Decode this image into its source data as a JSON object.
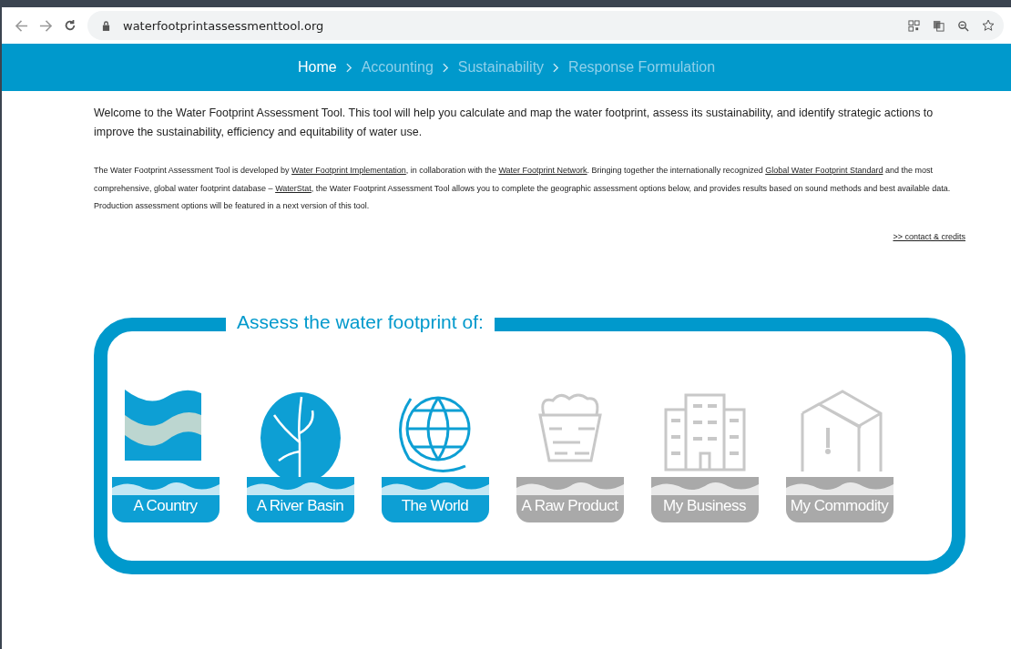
{
  "browser": {
    "url": "waterfootprintassessmenttool.org"
  },
  "breadcrumb": [
    {
      "label": "Home",
      "selected": true
    },
    {
      "label": "Accounting",
      "selected": false
    },
    {
      "label": "Sustainability",
      "selected": false
    },
    {
      "label": "Response Formulation",
      "selected": false
    }
  ],
  "intro": "Welcome to the Water Footprint Assessment Tool. This tool will help you calculate and map the water footprint, assess its sustainability, and identify strategic actions to improve the sustainability, efficiency and equitability of water use.",
  "description": [
    {
      "kind": "text",
      "text": "The Water Footprint Assessment Tool is developed by "
    },
    {
      "kind": "link",
      "text": "Water Footprint Implementation"
    },
    {
      "kind": "text",
      "text": ", in collaboration with the "
    },
    {
      "kind": "link",
      "text": "Water Footprint Network"
    },
    {
      "kind": "text",
      "text": ". Bringing together the internationally recognized "
    },
    {
      "kind": "link",
      "text": "Global Water Footprint Standard"
    },
    {
      "kind": "text",
      "text": " and the most comprehensive, global water footprint database – "
    },
    {
      "kind": "link",
      "text": "WaterStat"
    },
    {
      "kind": "text",
      "text": ", the Water Footprint Assessment Tool allows you to complete the geographic assessment options below, and provides results based on sound methods and best available data. Production assessment options will be featured in a next version of this tool."
    }
  ],
  "contact_link": ">> contact & credits",
  "assess": {
    "title": "Assess the water footprint of:",
    "options": [
      {
        "kind": "country",
        "label": "A Country",
        "disabled": false
      },
      {
        "kind": "basin",
        "label": "A River Basin",
        "disabled": false
      },
      {
        "kind": "world",
        "label": "The World",
        "disabled": false
      },
      {
        "kind": "product",
        "label": "A Raw Product",
        "disabled": true
      },
      {
        "kind": "business",
        "label": "My Business",
        "disabled": true
      },
      {
        "kind": "commodity",
        "label": "My Commodity",
        "disabled": true
      }
    ]
  }
}
